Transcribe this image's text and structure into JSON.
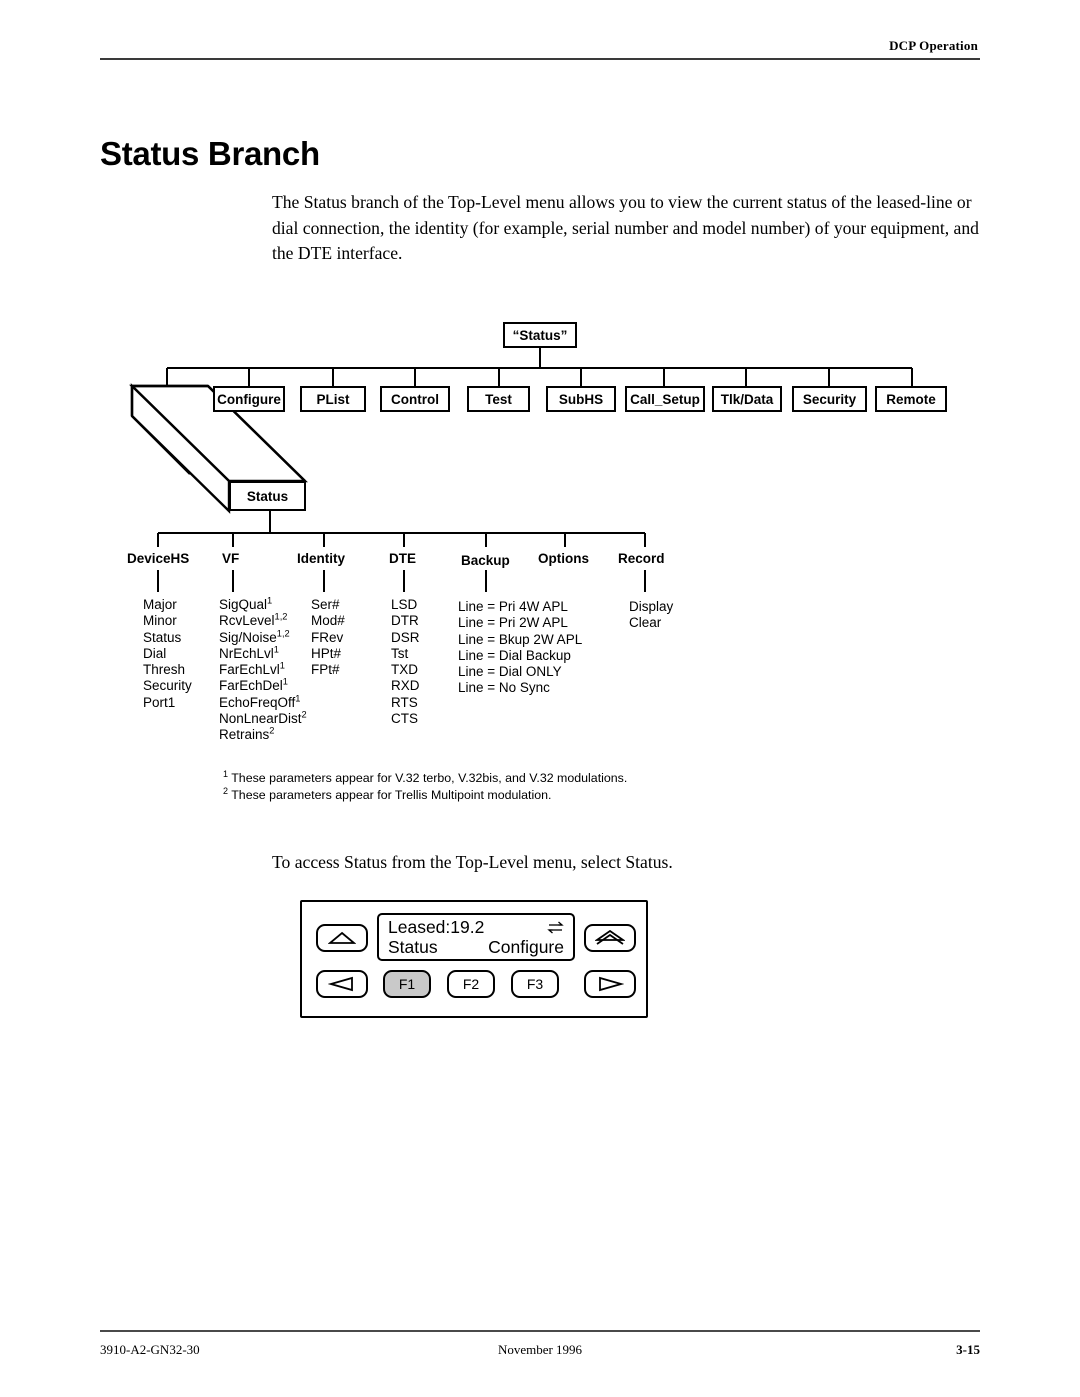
{
  "header": {
    "title": "DCP Operation"
  },
  "page": {
    "title": "Status Branch",
    "intro": "The Status branch of the Top-Level menu allows you to view the current status of the leased-line or dial connection, the identity (for example, serial number and model number) of your equipment, and the DTE interface.",
    "access_sentence": "To access Status from the Top-Level menu, select Status."
  },
  "tree": {
    "root": {
      "label": "“Status”"
    },
    "top_level": [
      {
        "label": "Configure"
      },
      {
        "label": "PList"
      },
      {
        "label": "Control"
      },
      {
        "label": "Test"
      },
      {
        "label": "SubHS"
      },
      {
        "label": "Call_Setup"
      },
      {
        "label": "Tlk/Data"
      },
      {
        "label": "Security"
      },
      {
        "label": "Remote"
      }
    ],
    "selected_node": {
      "label": "Status"
    },
    "columns": [
      {
        "head": "DeviceHS",
        "items": [
          "Major",
          "Minor",
          "Status",
          "Dial",
          "Thresh",
          "Security",
          "Port1"
        ]
      },
      {
        "head": "VF",
        "items": [
          "SigQual|1",
          "RcvLevel|1,2",
          "Sig/Noise|1,2",
          "NrEchLvl|1",
          "FarEchLvl|1",
          "FarEchDel|1",
          "EchoFreqOff|1",
          "NonLnearDist|2",
          "Retrains|2"
        ]
      },
      {
        "head": "Identity",
        "items": [
          "Ser#",
          "Mod#",
          "FRev",
          "HPt#",
          "FPt#"
        ]
      },
      {
        "head": "DTE",
        "items": [
          "LSD",
          "DTR",
          "DSR",
          "Tst",
          "TXD",
          "RXD",
          "RTS",
          "CTS"
        ]
      },
      {
        "head": "Backup",
        "items": [
          "Line = Pri 4W APL",
          "Line = Pri 2W APL",
          "Line = Bkup 2W APL",
          "Line = Dial Backup",
          "Line = Dial ONLY",
          "Line = No Sync"
        ]
      },
      {
        "head": "Options",
        "items": []
      },
      {
        "head": "Record",
        "items": [
          "Display",
          "Clear"
        ]
      }
    ]
  },
  "footnotes": [
    {
      "marker": "1",
      "text": "These parameters appear for V.32 terbo, V.32bis, and V.32 modulations."
    },
    {
      "marker": "2",
      "text": "These parameters appear for Trellis Multipoint modulation."
    }
  ],
  "front_panel": {
    "lcd": {
      "line1": "Leased:19.2",
      "icon": "data-transfer-arrows-icon",
      "option_left": "Status",
      "option_right": "Configure"
    },
    "buttons": [
      {
        "name": "up-arrow-button",
        "label": ""
      },
      {
        "name": "home-arrow-button",
        "label": ""
      },
      {
        "name": "left-arrow-button",
        "label": ""
      },
      {
        "name": "f1-button",
        "label": "F1",
        "shaded": true
      },
      {
        "name": "f2-button",
        "label": "F2",
        "shaded": false
      },
      {
        "name": "f3-button",
        "label": "F3",
        "shaded": false
      },
      {
        "name": "right-arrow-button",
        "label": ""
      }
    ],
    "f1_label": "F1",
    "f2_label": "F2",
    "f3_label": "F3"
  },
  "footer": {
    "document_number": "3910-A2-GN32-30",
    "date": "November 1996",
    "page_number": "3-15"
  }
}
